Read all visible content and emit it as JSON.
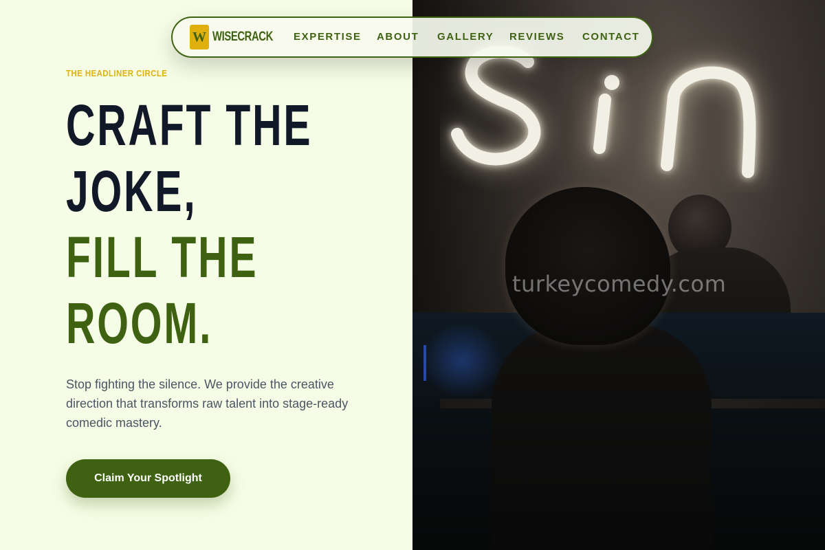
{
  "brand": {
    "badge_letter": "W",
    "name": "WISECRACK"
  },
  "nav": {
    "links": [
      {
        "label": "EXPERTISE"
      },
      {
        "label": "ABOUT"
      },
      {
        "label": "GALLERY"
      },
      {
        "label": "REVIEWS"
      },
      {
        "label": "CONTACT"
      }
    ]
  },
  "hero": {
    "eyebrow": "THE HEADLINER CIRCLE",
    "headline": {
      "line1": "CRAFT THE",
      "line2": "JOKE,",
      "line3": "FILL THE",
      "line4": "ROOM."
    },
    "body": "Stop fighting the silence. We provide the creative direction that transforms raw talent into stage-ready comedic mastery.",
    "cta_label": "Claim Your Spotlight"
  },
  "photo": {
    "neon_sign_text": "Sin",
    "watermark": "turkeycomedy.com"
  },
  "colors": {
    "background": "#f6fde6",
    "accent_green": "#3f6212",
    "accent_yellow": "#e0b10e",
    "headline_dark": "#111827",
    "body_text": "#4b5563"
  }
}
